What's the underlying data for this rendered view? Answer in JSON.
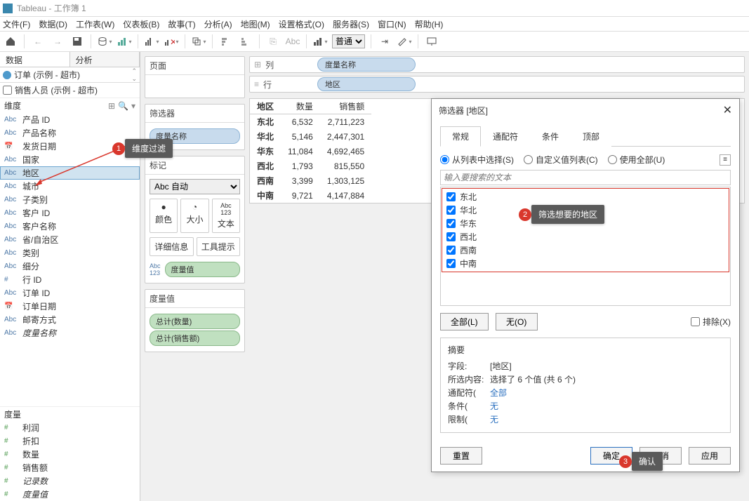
{
  "titlebar": {
    "app": "Tableau",
    "workbook": "工作簿 1"
  },
  "menu": {
    "file": "文件(F)",
    "data": "数据(D)",
    "worksheet": "工作表(W)",
    "dashboard": "仪表板(B)",
    "story": "故事(T)",
    "analysis": "分析(A)",
    "map": "地图(M)",
    "format": "设置格式(O)",
    "server": "服务器(S)",
    "window": "窗口(N)",
    "help": "帮助(H)"
  },
  "toolbar": {
    "fit_select": "普通",
    "abc": "Abc"
  },
  "sidebar": {
    "tab_data": "数据",
    "tab_analysis": "分析",
    "datasource": "订单 (示例 - 超市)",
    "salespeople": "销售人员 (示例 - 超市)",
    "section_dim": "维度",
    "dims": [
      {
        "icon": "Abc",
        "label": "产品 ID"
      },
      {
        "icon": "Abc",
        "label": "产品名称"
      },
      {
        "icon": "date",
        "label": "发货日期"
      },
      {
        "icon": "Abc",
        "label": "国家"
      },
      {
        "icon": "Abc",
        "label": "地区",
        "selected": true
      },
      {
        "icon": "Abc",
        "label": "城市"
      },
      {
        "icon": "Abc",
        "label": "子类别"
      },
      {
        "icon": "Abc",
        "label": "客户 ID"
      },
      {
        "icon": "Abc",
        "label": "客户名称"
      },
      {
        "icon": "Abc",
        "label": "省/自治区"
      },
      {
        "icon": "Abc",
        "label": "类别"
      },
      {
        "icon": "Abc",
        "label": "细分"
      },
      {
        "icon": "#",
        "label": "行 ID"
      },
      {
        "icon": "Abc",
        "label": "订单 ID"
      },
      {
        "icon": "date",
        "label": "订单日期"
      },
      {
        "icon": "Abc",
        "label": "邮寄方式"
      },
      {
        "icon": "Abc",
        "label": "度量名称",
        "italic": true
      }
    ],
    "section_meas": "度量",
    "meas": [
      {
        "icon": "#",
        "label": "利润"
      },
      {
        "icon": "#",
        "label": "折扣"
      },
      {
        "icon": "#",
        "label": "数量"
      },
      {
        "icon": "#",
        "label": "销售额"
      },
      {
        "icon": "#",
        "label": "记录数",
        "italic": true
      },
      {
        "icon": "#",
        "label": "度量值",
        "italic": true
      }
    ]
  },
  "shelves": {
    "pages_title": "页面",
    "filters_title": "筛选器",
    "filter_pill": "度量名称",
    "marks_title": "标记",
    "mark_type": "Abc 自动",
    "mark_color": "颜色",
    "mark_size": "大小",
    "mark_text": "文本",
    "mark_detail": "详细信息",
    "mark_tooltip": "工具提示",
    "mark_text_pill": "度量值",
    "measures_title": "度量值",
    "measure_pills": [
      "总计(数量)",
      "总计(销售额)"
    ]
  },
  "viz": {
    "columns_label": "列",
    "columns_pill": "度量名称",
    "rows_label": "行",
    "rows_pill": "地区",
    "headers": [
      "地区",
      "数量",
      "销售额"
    ],
    "rows": [
      {
        "region": "东北",
        "qty": "6,532",
        "sales": "2,711,223"
      },
      {
        "region": "华北",
        "qty": "5,146",
        "sales": "2,447,301"
      },
      {
        "region": "华东",
        "qty": "11,084",
        "sales": "4,692,465"
      },
      {
        "region": "西北",
        "qty": "1,793",
        "sales": "815,550"
      },
      {
        "region": "西南",
        "qty": "3,399",
        "sales": "1,303,125"
      },
      {
        "region": "中南",
        "qty": "9,721",
        "sales": "4,147,884"
      }
    ]
  },
  "callouts": {
    "c1": "维度过滤",
    "c2": "筛选想要的地区",
    "c3": "确认"
  },
  "dialog": {
    "title": "筛选器 [地区]",
    "tabs": {
      "general": "常规",
      "wildcard": "通配符",
      "condition": "条件",
      "top": "顶部"
    },
    "radios": {
      "from_list": "从列表中选择(S)",
      "custom": "自定义值列表(C)",
      "use_all": "使用全部(U)"
    },
    "search_placeholder": "输入要搜索的文本",
    "items": [
      "东北",
      "华北",
      "华东",
      "西北",
      "西南",
      "中南"
    ],
    "btn_all": "全部(L)",
    "btn_none": "无(O)",
    "exclude": "排除(X)",
    "summary": {
      "head": "摘要",
      "field_k": "字段:",
      "field_v": "[地区]",
      "sel_k": "所选内容:",
      "sel_v": "选择了 6 个值 (共 6 个)",
      "wc_k": "通配符(",
      "wc_v": "全部",
      "cond_k": "条件(",
      "cond_v": "无",
      "lim_k": "限制(",
      "lim_v": "无"
    },
    "btn_reset": "重置",
    "btn_ok": "确定",
    "btn_cancel": "取消",
    "btn_apply": "应用"
  }
}
